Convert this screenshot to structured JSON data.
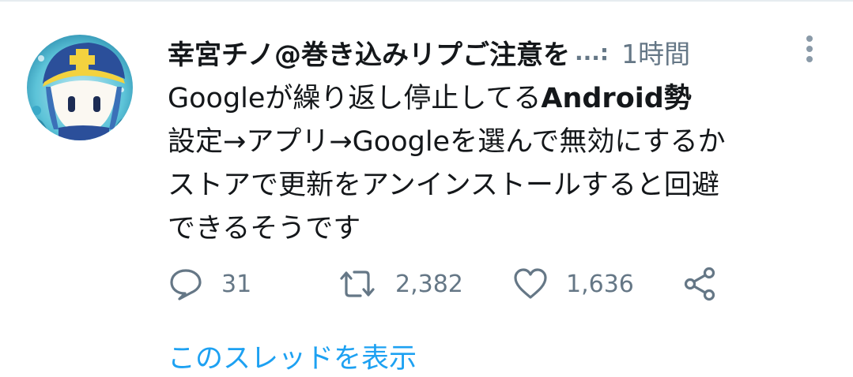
{
  "tweet": {
    "author_name": "幸宮チノ@巻き込みリプご注意を",
    "truncation_mark": "...:",
    "timestamp": "1時間",
    "body_lines": [
      {
        "text": "Googleが繰り返し停止してる",
        "bold": "Android勢"
      },
      {
        "text": "設定→アプリ→Googleを選んで無効にするか"
      },
      {
        "text": "ストアで更新をアンインストールすると回避"
      },
      {
        "text": "できるそうです"
      }
    ],
    "actions": {
      "reply_count": "31",
      "retweet_count": "2,382",
      "like_count": "1,636"
    },
    "thread_link": "このスレッドを表示"
  },
  "icons": {
    "reply": "speech-bubble-icon",
    "retweet": "retweet-arrows-icon",
    "like": "heart-outline-icon",
    "share": "share-nodes-icon",
    "more": "vertical-dots-icon"
  },
  "colors": {
    "text_primary": "#14171a",
    "text_secondary": "#657786",
    "link": "#1da1f2"
  }
}
